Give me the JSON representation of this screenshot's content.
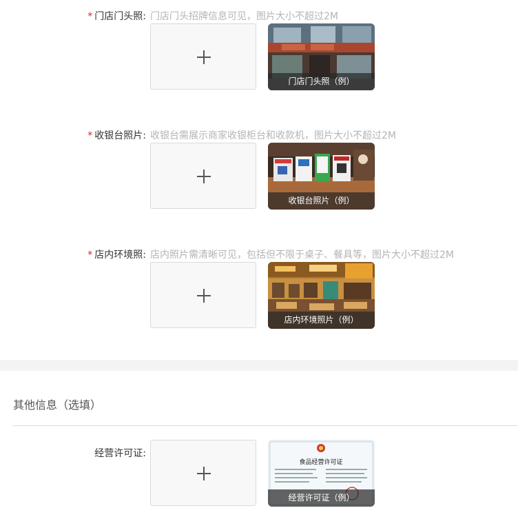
{
  "uploads": [
    {
      "required_mark": "*",
      "label": "门店门头照:",
      "hint": "门店门头招牌信息可见，图片大小不超过2M",
      "example_caption": "门店门头照（例）",
      "example_icon": "storefront-photo"
    },
    {
      "required_mark": "*",
      "label": "收银台照片:",
      "hint": "收银台需展示商家收银柜台和收款机，图片大小不超过2M",
      "example_caption": "收银台照片（例）",
      "example_icon": "cashier-counter-photo"
    },
    {
      "required_mark": "*",
      "label": "店内环境照:",
      "hint": "店内照片需清晰可见，包括但不限于桌子、餐具等，图片大小不超过2M",
      "example_caption": "店内环境照片（例）",
      "example_icon": "interior-photo"
    }
  ],
  "other_section": {
    "title": "其他信息（选填）",
    "license": {
      "label": "经营许可证:",
      "example_caption": "经营许可证（例）",
      "example_icon": "license-photo",
      "license_title": "食品经营许可证"
    }
  },
  "colors": {
    "required": "#e02020",
    "hint": "#b4b4b4",
    "label": "#333333",
    "band": "#f3f3f3"
  }
}
